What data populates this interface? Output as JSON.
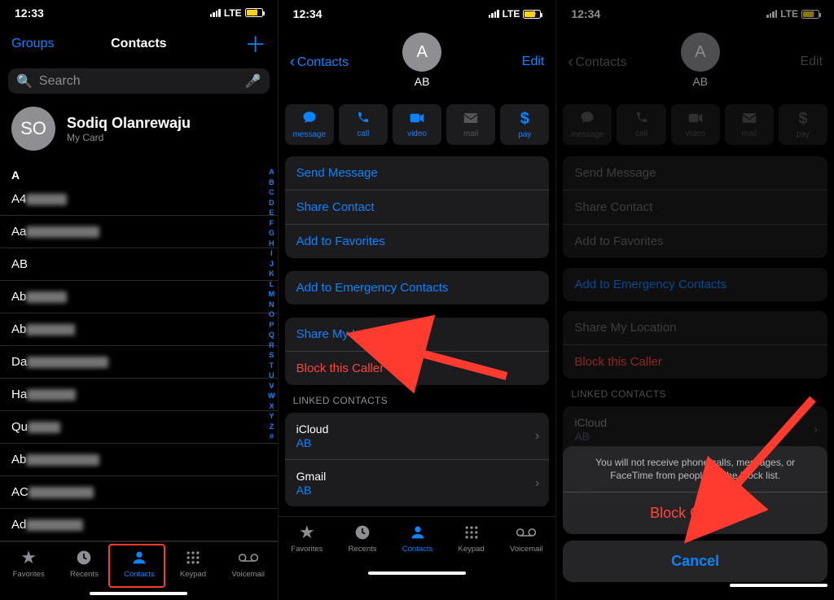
{
  "status": {
    "time1": "12:33",
    "time2": "12:34",
    "time3": "12:34",
    "net": "LTE"
  },
  "colors": {
    "blue": "#0a84ff",
    "red": "#ff453a"
  },
  "pane1": {
    "nav_left": "Groups",
    "nav_title": "Contacts",
    "search_placeholder": "Search",
    "mycard_initials": "SO",
    "mycard_name": "Sodiq Olanrewaju",
    "mycard_sub": "My Card",
    "section": "A",
    "rows": [
      "A4",
      "Aa",
      "AB",
      "Ab",
      "Ab",
      "Da",
      "Ha",
      "Qu",
      "Ab",
      "AC",
      "Ad"
    ],
    "index": "A B C D E F G H I J K L M N O P Q R S T U V W X Y Z #"
  },
  "tabbar": {
    "items": [
      {
        "name": "favorites",
        "label": "Favorites"
      },
      {
        "name": "recents",
        "label": "Recents"
      },
      {
        "name": "contacts",
        "label": "Contacts"
      },
      {
        "name": "keypad",
        "label": "Keypad"
      },
      {
        "name": "voicemail",
        "label": "Voicemail"
      }
    ]
  },
  "contact": {
    "back": "Contacts",
    "edit": "Edit",
    "initial": "A",
    "name": "AB",
    "qa": [
      {
        "name": "message",
        "label": "message"
      },
      {
        "name": "call",
        "label": "call"
      },
      {
        "name": "video",
        "label": "video"
      },
      {
        "name": "mail",
        "label": "mail",
        "disabled": true
      },
      {
        "name": "pay",
        "label": "pay"
      }
    ],
    "g1": [
      "Send Message",
      "Share Contact",
      "Add to Favorites"
    ],
    "g2": [
      "Add to Emergency Contacts"
    ],
    "g3_share": "Share My Location",
    "g3_block": "Block this Caller",
    "linked_hdr": "LINKED CONTACTS",
    "linked": [
      {
        "src": "iCloud",
        "val": "AB"
      },
      {
        "src": "Gmail",
        "val": "AB"
      }
    ]
  },
  "sheet": {
    "msg": "You will not receive phone calls, messages, or FaceTime from people on the block list.",
    "block": "Block Contact",
    "cancel": "Cancel"
  }
}
